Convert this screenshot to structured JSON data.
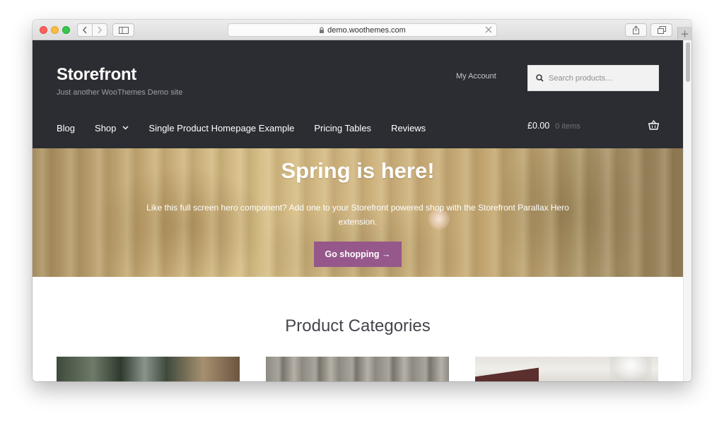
{
  "browser": {
    "url": "demo.woothemes.com",
    "new_tab_symbol": "+"
  },
  "header": {
    "site_title": "Storefront",
    "tagline": "Just another WooThemes Demo site",
    "my_account": "My Account",
    "search_placeholder": "Search products…"
  },
  "nav": {
    "items": [
      {
        "label": "Blog"
      },
      {
        "label": "Shop"
      },
      {
        "label": "Single Product Homepage Example"
      },
      {
        "label": "Pricing Tables"
      },
      {
        "label": "Reviews"
      }
    ]
  },
  "cart": {
    "total": "£0.00",
    "count": "0 items"
  },
  "hero": {
    "title": "Spring is here!",
    "text": "Like this full screen hero component? Add one to your Storefront powered shop with the Storefront Parallax Hero extension.",
    "button": "Go shopping →"
  },
  "content": {
    "section_title": "Product Categories"
  },
  "colors": {
    "header_bg": "#2c2d33",
    "accent": "#96588a"
  }
}
